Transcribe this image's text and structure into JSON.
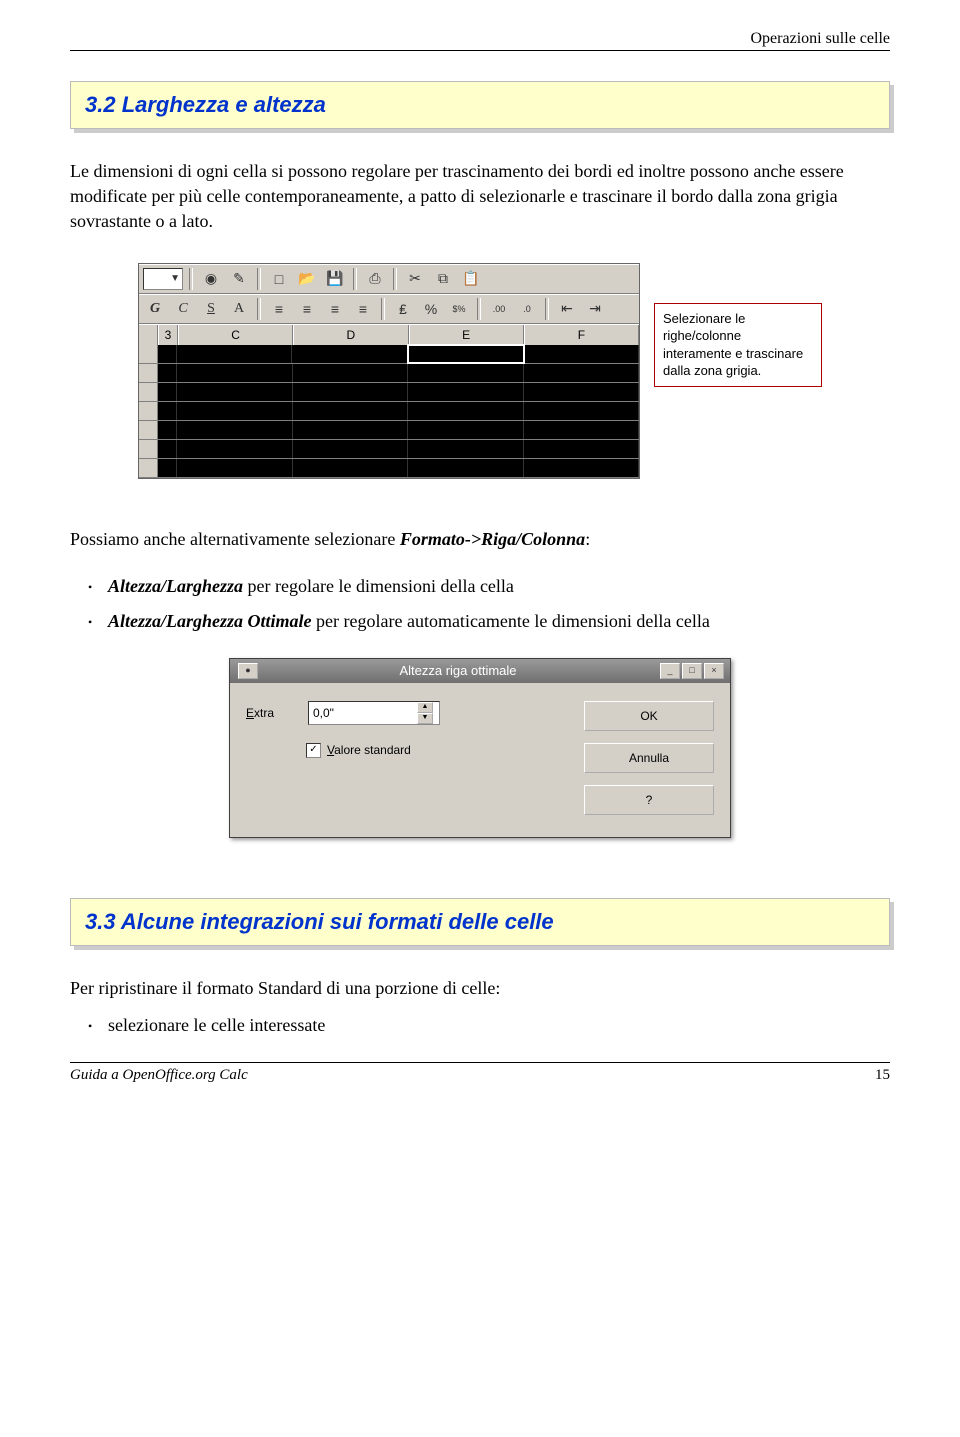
{
  "header": {
    "title": "Operazioni sulle celle"
  },
  "section1": {
    "heading": "3.2 Larghezza e altezza",
    "paragraph": "Le dimensioni di ogni cella si possono regolare per trascinamento dei bordi ed inoltre possono anche essere modificate per più celle contemporaneamente, a patto di selezionarle e trascinare il bordo dalla zona grigia sovrastante o a lato."
  },
  "screenshot1": {
    "col_headers": [
      "3",
      "C",
      "D",
      "E",
      "F"
    ],
    "format_labels": [
      "G",
      "C",
      "S",
      "A"
    ],
    "callout": "Selezionare le righe/colonne interamente e trascinare dalla zona grigia."
  },
  "para2": {
    "prefix": "Possiamo anche alternativamente selezionare ",
    "menu": "Formato->Riga/Colonna",
    "suffix": ":"
  },
  "bullets": {
    "item1_bold": "Altezza/Larghezza",
    "item1_rest": " per regolare le dimensioni della cella",
    "item2_bold": "Altezza/Larghezza Ottimale",
    "item2_rest": " per regolare automaticamente le dimensioni della cella"
  },
  "dialog": {
    "title": "Altezza riga ottimale",
    "extra_label": "Extra",
    "extra_label_u": "E",
    "extra_value": "0,0\"",
    "check_label": "Valore standard",
    "check_label_u": "V",
    "buttons": {
      "ok": "OK",
      "cancel": "Annulla",
      "help": "?"
    }
  },
  "section2": {
    "heading": "3.3 Alcune integrazioni sui formati delle celle",
    "paragraph": "Per ripristinare il formato Standard di una porzione di celle:",
    "bullet": "selezionare le celle interessate"
  },
  "footer": {
    "left": "Guida a OpenOffice.org Calc",
    "page": "15"
  }
}
